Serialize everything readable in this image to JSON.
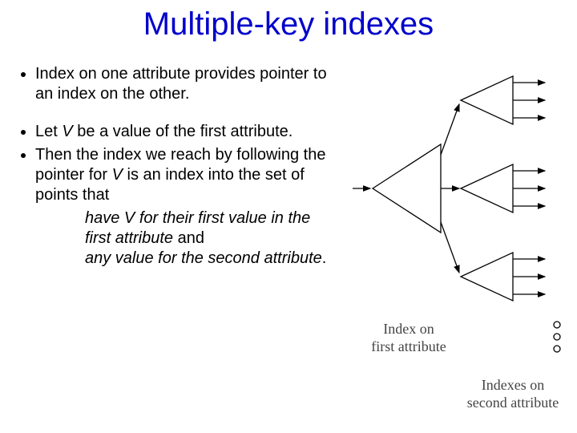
{
  "title": "Multiple-key indexes",
  "bullets": {
    "b1": "Index on one attribute provides pointer to an index on the other.",
    "b2_pre": "Let ",
    "b2_v": "V",
    "b2_post": " be a value of the first attribute.",
    "b3_pre": "Then the index we reach by following the pointer for ",
    "b3_v": "V",
    "b3_post": " is an index into the set of points that",
    "indent1_a": "have V for their first value in the first attribute",
    "indent1_b": " and",
    "indent2": "any value for the second attribute",
    "indent2_dot": "."
  },
  "figure": {
    "label1_a": "Index on",
    "label1_b": "first attribute",
    "label2_a": "Indexes on",
    "label2_b": "second attribute"
  }
}
